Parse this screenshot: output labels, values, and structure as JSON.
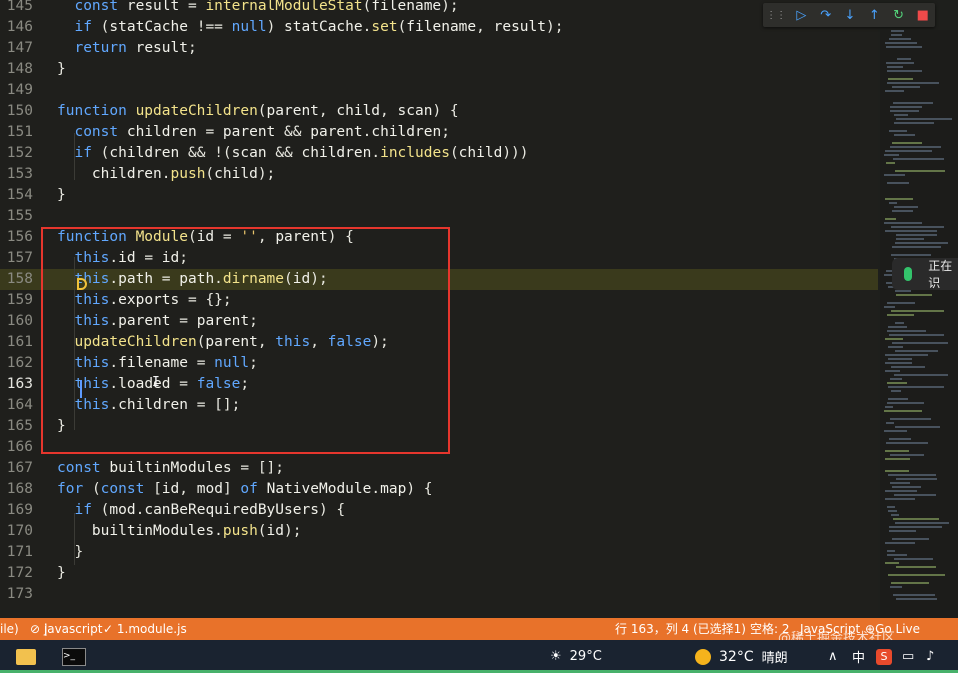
{
  "editor": {
    "current_line": "163",
    "lines": [
      {
        "n": "145",
        "code": "  const result = internalModuleStat(filename);"
      },
      {
        "n": "146",
        "code": "  if (statCache !== null) statCache.set(filename, result);"
      },
      {
        "n": "147",
        "code": "  return result;"
      },
      {
        "n": "148",
        "code": "}"
      },
      {
        "n": "149",
        "code": ""
      },
      {
        "n": "150",
        "code": "function updateChildren(parent, child, scan) {"
      },
      {
        "n": "151",
        "code": "  const children = parent && parent.children;"
      },
      {
        "n": "152",
        "code": "  if (children && !(scan && children.includes(child)))"
      },
      {
        "n": "153",
        "code": "    children.push(child);"
      },
      {
        "n": "154",
        "code": "}"
      },
      {
        "n": "155",
        "code": ""
      },
      {
        "n": "156",
        "code": "function Module(id = '', parent) {"
      },
      {
        "n": "157",
        "code": "  this.id = id;"
      },
      {
        "n": "158",
        "code": "  this.path = path.dirname(id);"
      },
      {
        "n": "159",
        "code": "  this.exports = {};"
      },
      {
        "n": "160",
        "code": "  this.parent = parent;"
      },
      {
        "n": "161",
        "code": "  updateChildren(parent, this, false);"
      },
      {
        "n": "162",
        "code": "  this.filename = null;"
      },
      {
        "n": "163",
        "code": "  this.loaded = false;"
      },
      {
        "n": "164",
        "code": "  this.children = [];"
      },
      {
        "n": "165",
        "code": "}"
      },
      {
        "n": "166",
        "code": ""
      },
      {
        "n": "167",
        "code": "const builtinModules = [];"
      },
      {
        "n": "168",
        "code": "for (const [id, mod] of NativeModule.map) {"
      },
      {
        "n": "169",
        "code": "  if (mod.canBeRequiredByUsers) {"
      },
      {
        "n": "170",
        "code": "    builtinModules.push(id);"
      },
      {
        "n": "171",
        "code": "  }"
      },
      {
        "n": "172",
        "code": "}"
      },
      {
        "n": "173",
        "code": ""
      }
    ]
  },
  "debug_toolbar": {
    "buttons": [
      {
        "icon": "continue-icon",
        "glyph": "▷",
        "color": "#4aa3ff"
      },
      {
        "icon": "step-over-icon",
        "glyph": "↷",
        "color": "#4aa3ff"
      },
      {
        "icon": "step-into-icon",
        "glyph": "↓",
        "color": "#4aa3ff"
      },
      {
        "icon": "step-out-icon",
        "glyph": "↑",
        "color": "#4aa3ff"
      },
      {
        "icon": "restart-icon",
        "glyph": "↻",
        "color": "#54d27a"
      },
      {
        "icon": "stop-icon",
        "glyph": "■",
        "color": "#f04a4a"
      }
    ]
  },
  "overlay": {
    "voice_text": "正在识"
  },
  "status_bar": {
    "mode": "ile)",
    "language_badge": "javascript",
    "file": "✓ 1.module.js",
    "cursor_pos": "行 163，列 4 (已选择1)",
    "indent": "空格: 2",
    "language": "JavaScript",
    "live": "Go Live",
    "watermark": "@稀土掘金技术社区"
  },
  "taskbar": {
    "weather_temp": "29°C",
    "temp": "32°C",
    "condition": "晴朗",
    "ime": "中"
  },
  "colors": {
    "status_bar": "#e8722a",
    "highlight_box": "#e6362d",
    "exec_line": "#3a3a1c",
    "accent": "#4aa3ff"
  }
}
